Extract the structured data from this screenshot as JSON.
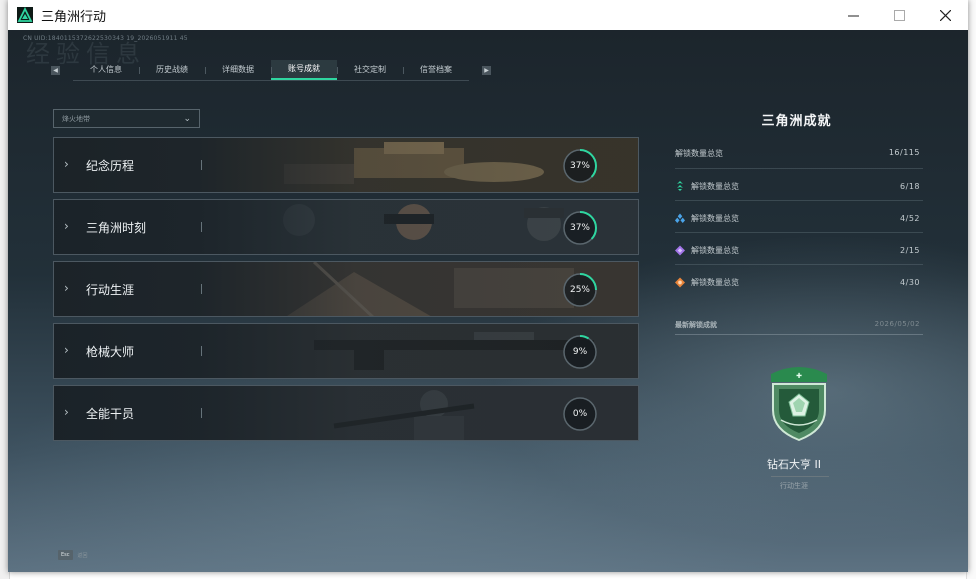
{
  "window": {
    "title": "三角洲行动"
  },
  "header": {
    "cn_uid": "CN UID:1840115372622530343 19_2026051911 45",
    "bg_title": "经验信息"
  },
  "tabs": [
    {
      "label": "个人信息",
      "active": false
    },
    {
      "label": "历史战绩",
      "active": false
    },
    {
      "label": "详细数据",
      "active": false
    },
    {
      "label": "账号成就",
      "active": true
    },
    {
      "label": "社交定制",
      "active": false
    },
    {
      "label": "信誉档案",
      "active": false
    }
  ],
  "filter": {
    "value": "烽火地带"
  },
  "categories": [
    {
      "name": "纪念历程",
      "percent": 37,
      "percent_label": "37%"
    },
    {
      "name": "三角洲时刻",
      "percent": 37,
      "percent_label": "37%"
    },
    {
      "name": "行动生涯",
      "percent": 25,
      "percent_label": "25%"
    },
    {
      "name": "枪械大师",
      "percent": 9,
      "percent_label": "9%"
    },
    {
      "name": "全能干员",
      "percent": 0,
      "percent_label": "0%"
    }
  ],
  "summary": {
    "title": "三角洲成就",
    "total_label": "解锁数量总览",
    "total_value": "16/115",
    "rows": [
      {
        "label": "解锁数量总览",
        "value": "6/18",
        "icon": "green-chevron-icon",
        "color": "#2fd6a0"
      },
      {
        "label": "解锁数量总览",
        "value": "4/52",
        "icon": "blue-diamond-icon",
        "color": "#4aa3e8"
      },
      {
        "label": "解锁数量总览",
        "value": "2/15",
        "icon": "purple-diamond-icon",
        "color": "#a274e8"
      },
      {
        "label": "解锁数量总览",
        "value": "4/30",
        "icon": "orange-diamond-icon",
        "color": "#e8843a"
      }
    ]
  },
  "latest": {
    "label": "最新解锁成就",
    "date": "2026/05/02",
    "badge_name": "钻石大亨 II",
    "badge_category": "行动生涯"
  },
  "footer": {
    "key": "Esc",
    "label": "返回"
  }
}
